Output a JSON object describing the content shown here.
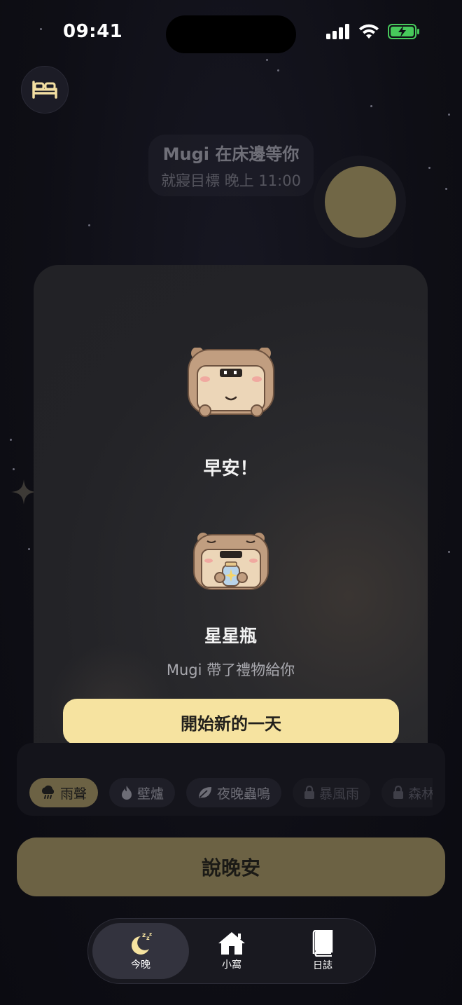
{
  "status_bar": {
    "time": "09:41"
  },
  "header": {
    "title": "Mugi 在床邊等你",
    "subtitle": "就寢目標 晚上 11:00"
  },
  "modal": {
    "greeting": "早安！",
    "gift_name": "星星瓶",
    "gift_description": "Mugi 帶了禮物給你",
    "start_button": "開始新的一天"
  },
  "sounds": [
    {
      "label": "雨聲",
      "icon": "rain-cloud-icon",
      "state": "active"
    },
    {
      "label": "壁爐",
      "icon": "flame-icon",
      "state": "available"
    },
    {
      "label": "夜晚蟲鳴",
      "icon": "leaf-icon",
      "state": "available"
    },
    {
      "label": "暴風雨",
      "icon": "lock-icon",
      "state": "locked"
    },
    {
      "label": "森林溪",
      "icon": "lock-icon",
      "state": "locked"
    }
  ],
  "main_action": {
    "label": "說晚安"
  },
  "tabs": [
    {
      "label": "今晚",
      "icon": "moon-sleep-icon",
      "active": true
    },
    {
      "label": "小窩",
      "icon": "house-icon",
      "active": false
    },
    {
      "label": "日誌",
      "icon": "book-icon",
      "active": false
    }
  ],
  "colors": {
    "background": "#0f0f17",
    "accent_gold": "#6c6244",
    "button_cream": "#f6e3a0",
    "moon": "#716746"
  }
}
